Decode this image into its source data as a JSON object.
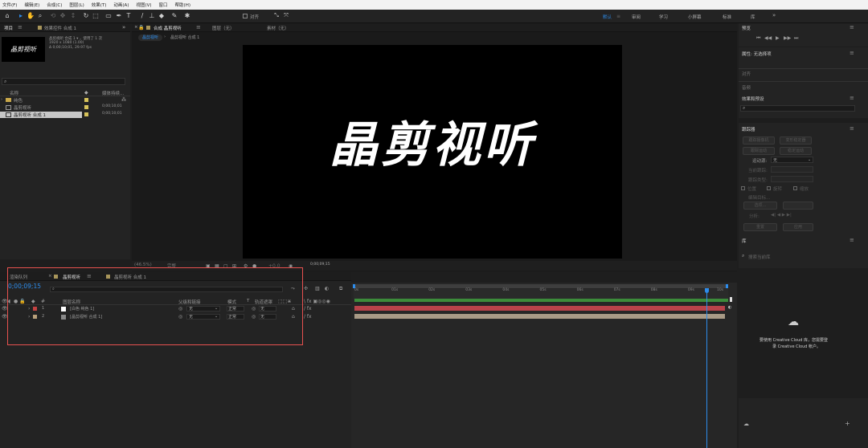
{
  "menu": [
    "文件(F)",
    "编辑(E)",
    "合成(C)",
    "图层(L)",
    "效果(T)",
    "动画(A)",
    "视图(V)",
    "窗口",
    "帮助(H)"
  ],
  "toolbar": {
    "align_label": "对齐",
    "workspaces": [
      {
        "label": "默认",
        "active": true
      },
      {
        "label": "审阅",
        "active": false
      },
      {
        "label": "学习",
        "active": false
      },
      {
        "label": "小屏幕",
        "active": false
      },
      {
        "label": "标准",
        "active": false
      },
      {
        "label": "库",
        "active": false
      }
    ],
    "more": "»"
  },
  "project": {
    "tab_label": "项目",
    "effects_tab": "效果控件 合成 1",
    "thumb_text": "晶剪视听",
    "info_name": "晶剪视听 合成 1 ▾ ，使用了 1 次",
    "info_res": "1920 x 1080 (1.00)",
    "info_dur": "Δ 0;00;10;01, 29.97 fps",
    "col_name": "名称",
    "col_type": "媒体持续...",
    "items": [
      {
        "name": "纯色",
        "color": "#d6c25a",
        "duration": ""
      },
      {
        "name": "晶剪视听",
        "color": "#d6c25a",
        "duration": "0;00;10;01"
      },
      {
        "name": "晶剪视听 合成 1",
        "color": "#d6c25a",
        "duration": "0;00;10;01"
      }
    ]
  },
  "comp": {
    "tab_label": "合成 晶剪视听",
    "layer_tab": "图层（无）",
    "footage_tab": "素材（无）",
    "crumb1": "晶剪视听",
    "crumb2": "晶剪视听 合成 1",
    "title_text": "晶剪视听",
    "zoom": "(46.5%)",
    "quality": "完整",
    "timecode": "0;00;09;15"
  },
  "right": {
    "preview_title": "预览",
    "props_title": "属性: 无选择项",
    "align": "对齐",
    "audio": "音频",
    "presets_title": "效果和预设",
    "tracker_title": "跟踪器",
    "tracker_buttons": [
      "跟踪摄像机",
      "变形稳定器",
      "跟踪运动",
      "稳定运动"
    ],
    "motion_source_label": "运动源:",
    "motion_source_value": "无",
    "current_track": "当前跟踪:",
    "track_type": "跟踪类型:",
    "check_position": "位置",
    "check_rotation": "旋转",
    "check_scale": "缩放",
    "edit_target": "编辑目标...",
    "options": "选项...",
    "analyze": "分析:",
    "reset": "重置",
    "apply": "应用",
    "library_title": "库",
    "library_search": "搜索当前库",
    "cloud_msg1": "要使用 Creative Cloud 库，您需要登",
    "cloud_msg2": "录 Creative Cloud 帐户。"
  },
  "timeline": {
    "render_tab": "渲染队列",
    "tab1": "晶剪视听",
    "tab2": "晶剪视听 合成 1",
    "timecode": "0;00;09;15",
    "col_layer": "图层名称",
    "col_parent": "父级和链接",
    "col_mode": "模式",
    "col_t": "T",
    "col_trkmat": "轨道遮罩",
    "layers": [
      {
        "num": "1",
        "name": "[白色 纯色 1]",
        "label_color": "#c44242",
        "thumb": "#ffffff",
        "parent": "无",
        "mode": "正常",
        "matte": "无"
      },
      {
        "num": "2",
        "name": "[晶剪视听 合成 1]",
        "label_color": "#b8a07a",
        "thumb": "#888888",
        "parent": "无",
        "mode": "正常",
        "matte": "无"
      }
    ],
    "ruler": [
      "0s",
      "01s",
      "02s",
      "03s",
      "04s",
      "05s",
      "06s",
      "07s",
      "08s",
      "09s",
      "10s"
    ],
    "playhead_fraction": 0.95
  },
  "colors": {
    "accent": "#2d8ceb",
    "highlight": "#e8514f"
  }
}
